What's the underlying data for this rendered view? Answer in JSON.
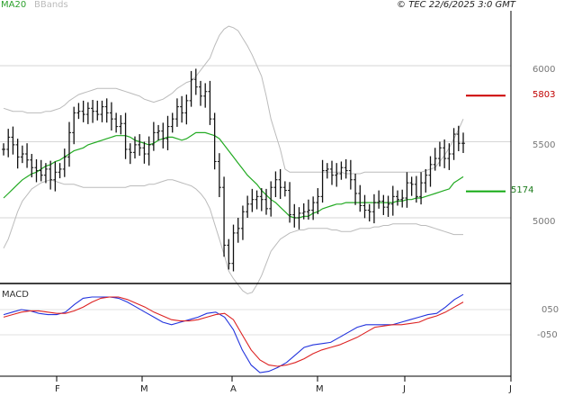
{
  "legend": {
    "ma": "MA20",
    "bb": "BBands"
  },
  "copyright": "© TEC 22/6/2025 3:0 GMT",
  "price_ticks": [
    "6000",
    "5500",
    "5000"
  ],
  "macd_label": "MACD",
  "macd_ticks": [
    "050",
    "-050"
  ],
  "x_ticks": [
    "F",
    "M",
    "A",
    "M",
    "J",
    "J"
  ],
  "levels": {
    "resistance": "5803",
    "support": "5174"
  },
  "colors": {
    "ma": "#22aa22",
    "bb": "#bbbbbb",
    "bars": "#111111",
    "macd_line": "#2233dd",
    "macd_signal": "#dd2222",
    "resistance": "#cc0000",
    "support": "#11aa11"
  },
  "chart_data": [
    {
      "type": "ohlc",
      "title": "",
      "ylim": [
        4580,
        6450
      ],
      "y_ticks": [
        5000,
        5500,
        6000
      ],
      "grid": true,
      "x": [
        "2025-01-31",
        "2025-02-03",
        "2025-02-04",
        "2025-02-05",
        "2025-02-06",
        "2025-02-07",
        "2025-02-10",
        "2025-02-11",
        "2025-02-12",
        "2025-02-13",
        "2025-02-14",
        "2025-02-17",
        "2025-02-18",
        "2025-02-19",
        "2025-02-20",
        "2025-02-21",
        "2025-02-24",
        "2025-02-25",
        "2025-02-26",
        "2025-02-27",
        "2025-02-28",
        "2025-03-03",
        "2025-03-04",
        "2025-03-05",
        "2025-03-06",
        "2025-03-07",
        "2025-03-10",
        "2025-03-11",
        "2025-03-12",
        "2025-03-13",
        "2025-03-14",
        "2025-03-17",
        "2025-03-18",
        "2025-03-19",
        "2025-03-20",
        "2025-03-21",
        "2025-03-24",
        "2025-03-25",
        "2025-03-26",
        "2025-03-27",
        "2025-03-28",
        "2025-03-31",
        "2025-04-01",
        "2025-04-02",
        "2025-04-03",
        "2025-04-04",
        "2025-04-07",
        "2025-04-08",
        "2025-04-09",
        "2025-04-10",
        "2025-04-11",
        "2025-04-14",
        "2025-04-15",
        "2025-04-16",
        "2025-04-17",
        "2025-04-21",
        "2025-04-22",
        "2025-04-23",
        "2025-04-24",
        "2025-04-25",
        "2025-04-28",
        "2025-04-29",
        "2025-04-30",
        "2025-05-01",
        "2025-05-02",
        "2025-05-05",
        "2025-05-06",
        "2025-05-07",
        "2025-05-08",
        "2025-05-09",
        "2025-05-12",
        "2025-05-13",
        "2025-05-14",
        "2025-05-15",
        "2025-05-16",
        "2025-05-19",
        "2025-05-20",
        "2025-05-21",
        "2025-05-22",
        "2025-05-23",
        "2025-05-27",
        "2025-05-28",
        "2025-05-29",
        "2025-05-30",
        "2025-06-02",
        "2025-06-03",
        "2025-06-04",
        "2025-06-05",
        "2025-06-06",
        "2025-06-09",
        "2025-06-10",
        "2025-06-11",
        "2025-06-12",
        "2025-06-13",
        "2025-06-16",
        "2025-06-17",
        "2025-06-18",
        "2025-06-19",
        "2025-06-20"
      ],
      "series": [
        {
          "name": "",
          "values": [
            5450,
            5530,
            5480,
            5400,
            5420,
            5380,
            5330,
            5310,
            5280,
            5320,
            5250,
            5300,
            5320,
            5400,
            5560,
            5690,
            5700,
            5680,
            5720,
            5700,
            5680,
            5730,
            5690,
            5650,
            5600,
            5620,
            5450,
            5430,
            5480,
            5460,
            5420,
            5480,
            5560,
            5570,
            5520,
            5600,
            5650,
            5730,
            5690,
            5770,
            5910,
            5860,
            5800,
            5830,
            5650,
            5370,
            5200,
            4820,
            4700,
            4900,
            4930,
            5040,
            5090,
            5120,
            5140,
            5120,
            5060,
            5200,
            5250,
            5200,
            5180,
            5020,
            5000,
            5030,
            5040,
            5050,
            5100,
            5140,
            5310,
            5320,
            5280,
            5290,
            5330,
            5310,
            5250,
            5160,
            5080,
            5050,
            5040,
            5100,
            5110,
            5070,
            5090,
            5140,
            5120,
            5130,
            5230,
            5220,
            5140,
            5230,
            5280,
            5350,
            5390,
            5460,
            5390,
            5420,
            5550,
            5490,
            5490
          ]
        },
        {
          "name": "MA20",
          "values": [
            5130,
            5160,
            5190,
            5220,
            5250,
            5270,
            5290,
            5300,
            5320,
            5340,
            5350,
            5370,
            5380,
            5400,
            5420,
            5440,
            5450,
            5460,
            5480,
            5490,
            5500,
            5510,
            5520,
            5530,
            5540,
            5540,
            5540,
            5530,
            5510,
            5500,
            5490,
            5480,
            5490,
            5510,
            5520,
            5530,
            5530,
            5520,
            5510,
            5520,
            5540,
            5560,
            5560,
            5560,
            5550,
            5540,
            5520,
            5480,
            5440,
            5400,
            5360,
            5320,
            5280,
            5250,
            5220,
            5180,
            5150,
            5120,
            5100,
            5070,
            5040,
            5010,
            5000,
            5000,
            5010,
            5010,
            5030,
            5040,
            5060,
            5070,
            5080,
            5090,
            5090,
            5100,
            5100,
            5100,
            5100,
            5100,
            5100,
            5100,
            5100,
            5100,
            5100,
            5100,
            5110,
            5110,
            5120,
            5120,
            5130,
            5130,
            5140,
            5150,
            5160,
            5170,
            5180,
            5190,
            5230,
            5250,
            5270
          ]
        },
        {
          "name": "BBands upper",
          "values": [
            5720,
            5710,
            5700,
            5700,
            5700,
            5690,
            5690,
            5690,
            5690,
            5700,
            5700,
            5710,
            5720,
            5740,
            5770,
            5790,
            5810,
            5820,
            5830,
            5840,
            5850,
            5850,
            5850,
            5850,
            5850,
            5840,
            5830,
            5820,
            5810,
            5800,
            5780,
            5770,
            5760,
            5770,
            5780,
            5800,
            5820,
            5850,
            5870,
            5890,
            5900,
            5930,
            5970,
            6010,
            6050,
            6130,
            6200,
            6240,
            6260,
            6250,
            6230,
            6180,
            6130,
            6070,
            6000,
            5930,
            5800,
            5650,
            5550,
            5450,
            5320,
            5300,
            5300,
            5300,
            5300,
            5300,
            5300,
            5300,
            5300,
            5300,
            5300,
            5300,
            5300,
            5290,
            5290,
            5290,
            5290,
            5300,
            5300,
            5300,
            5300,
            5300,
            5300,
            5300,
            5300,
            5300,
            5300,
            5300,
            5300,
            5300,
            5310,
            5320,
            5330,
            5370,
            5410,
            5460,
            5520,
            5580,
            5650
          ]
        },
        {
          "name": "BBands lower",
          "values": [
            4800,
            4860,
            4950,
            5040,
            5110,
            5150,
            5190,
            5210,
            5230,
            5240,
            5250,
            5240,
            5230,
            5220,
            5220,
            5220,
            5210,
            5200,
            5200,
            5200,
            5200,
            5200,
            5200,
            5200,
            5200,
            5200,
            5200,
            5210,
            5210,
            5210,
            5210,
            5220,
            5220,
            5230,
            5240,
            5250,
            5250,
            5240,
            5230,
            5220,
            5210,
            5190,
            5160,
            5120,
            5060,
            4960,
            4860,
            4760,
            4650,
            4600,
            4560,
            4520,
            4500,
            4510,
            4560,
            4620,
            4700,
            4780,
            4820,
            4860,
            4880,
            4900,
            4910,
            4920,
            4920,
            4930,
            4930,
            4930,
            4930,
            4930,
            4920,
            4920,
            4910,
            4910,
            4910,
            4920,
            4930,
            4930,
            4930,
            4940,
            4940,
            4950,
            4950,
            4960,
            4960,
            4960,
            4960,
            4960,
            4960,
            4950,
            4950,
            4940,
            4930,
            4920,
            4910,
            4900,
            4890,
            4890,
            4890
          ]
        }
      ]
    },
    {
      "type": "line",
      "title": "MACD",
      "ylim": [
        -200,
        130
      ],
      "y_ticks": [
        50,
        -50
      ],
      "x": [
        "2025-01-31",
        "2025-06-20"
      ],
      "series": [
        {
          "name": "",
          "values": [
            30,
            40,
            50,
            45,
            35,
            30,
            30,
            40,
            70,
            95,
            100,
            100,
            100,
            95,
            80,
            60,
            40,
            20,
            0,
            -10,
            0,
            10,
            20,
            35,
            40,
            20,
            -30,
            -110,
            -170,
            -200,
            -195,
            -180,
            -160,
            -130,
            -100,
            -90,
            -85,
            -80,
            -60,
            -40,
            -20,
            -10,
            -10,
            -10,
            -10,
            0,
            10,
            20,
            30,
            35,
            60,
            90,
            110
          ]
        },
        {
          "name": "",
          "values": [
            20,
            30,
            40,
            45,
            45,
            40,
            35,
            35,
            45,
            60,
            80,
            95,
            100,
            100,
            90,
            75,
            60,
            40,
            25,
            10,
            5,
            5,
            10,
            20,
            30,
            35,
            10,
            -50,
            -110,
            -150,
            -170,
            -175,
            -170,
            -160,
            -145,
            -125,
            -110,
            -100,
            -90,
            -75,
            -60,
            -40,
            -20,
            -15,
            -10,
            -10,
            -5,
            0,
            15,
            25,
            40,
            60,
            80
          ]
        }
      ]
    }
  ]
}
